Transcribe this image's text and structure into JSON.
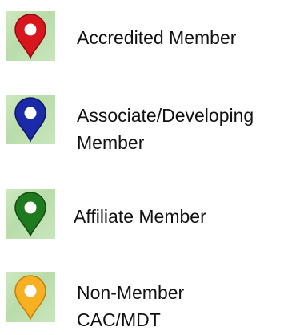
{
  "legend": {
    "items": [
      {
        "label_lines": [
          "Accredited Member"
        ],
        "icon": "map-pin-icon",
        "pin_color": "#d7161d",
        "pin_dark": "#8e0b10"
      },
      {
        "label_lines": [
          "Associate/Developing",
          "Member"
        ],
        "icon": "map-pin-icon",
        "pin_color": "#1b2aa8",
        "pin_dark": "#0c1466"
      },
      {
        "label_lines": [
          "Affiliate Member"
        ],
        "icon": "map-pin-icon",
        "pin_color": "#1f7a1f",
        "pin_dark": "#0f4d12"
      },
      {
        "label_lines": [
          "Non-Member",
          "CAC/MDT"
        ],
        "icon": "map-pin-icon",
        "pin_color": "#f6b021",
        "pin_dark": "#c47f0c"
      }
    ]
  }
}
